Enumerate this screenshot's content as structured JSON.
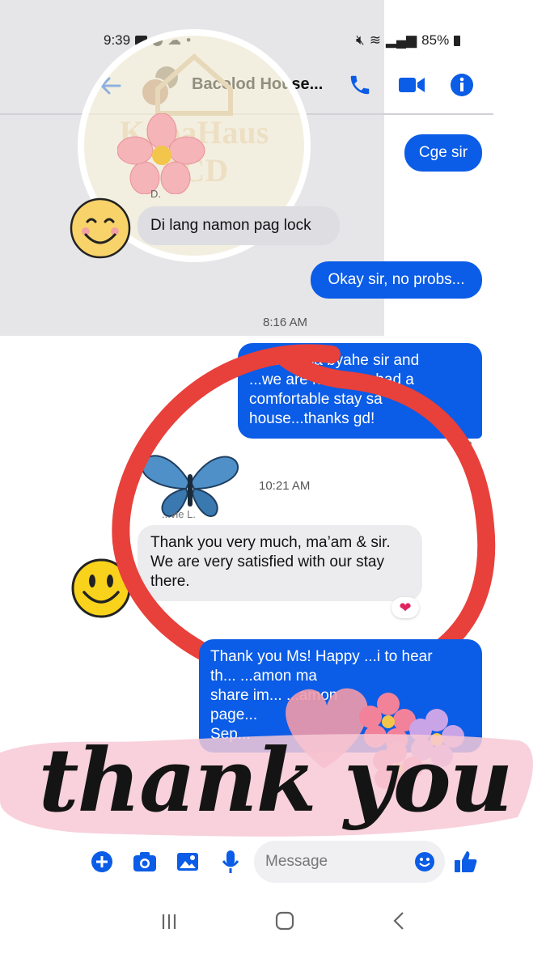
{
  "status_bar": {
    "time": "9:39",
    "battery": "85%"
  },
  "header": {
    "title": "Bacolod House..."
  },
  "watermark": {
    "text": "KubaHaus BCD"
  },
  "messages": {
    "m1": "Cge sir",
    "m2_sender": "D.",
    "m2": "Di lang namon pag lock",
    "m3": "Okay sir, no probs...",
    "time1": "8:16 AM",
    "m4_line1": "Halo...o sa byahe sir and",
    "m4_line2": "...we are ho... you had a",
    "m4_line3": "comfortable stay sa",
    "m4_line4": "house...thanks gd!",
    "m4_seen": "2",
    "time2": "10:21 AM",
    "m5_sender": "...vie L.",
    "m5_line1": "Thank you very much, ma’am & sir.",
    "m5_line2": "We are very satisfied with our stay",
    "m5_line3": "there.",
    "m6_line1": "Thank you Ms! Happy ...i to hear",
    "m6_line2": "th...  ...amon ma",
    "m6_line3": "share im...  ...amon",
    "m6_line4": "page...",
    "m6_line5": "Sep..."
  },
  "overlay": {
    "thank_you": "thank you"
  },
  "composer": {
    "placeholder": "Message"
  },
  "colors": {
    "accent": "#0b5ce6",
    "circle": "#e8403a",
    "heart": "#e0245e"
  }
}
